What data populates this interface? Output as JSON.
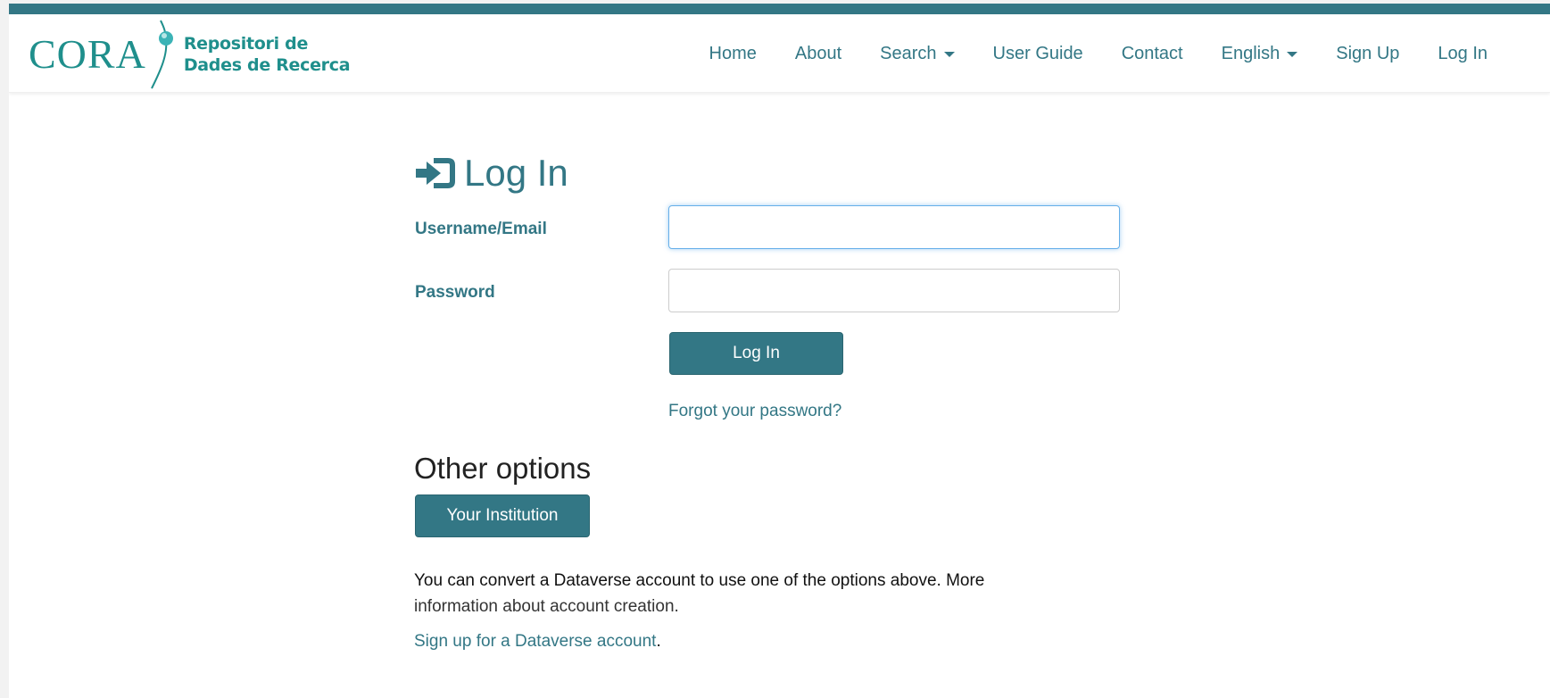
{
  "brand": {
    "logo_text": "CORA",
    "subtitle_line1": "Repositori de",
    "subtitle_line2": "Dades de Recerca",
    "color": "#1f8f8c"
  },
  "colors": {
    "accent": "#337785",
    "topbar": "#337785"
  },
  "nav": {
    "items": [
      {
        "label": "Home",
        "dropdown": false
      },
      {
        "label": "About",
        "dropdown": false
      },
      {
        "label": "Search",
        "dropdown": true
      },
      {
        "label": "User Guide",
        "dropdown": false
      },
      {
        "label": "Contact",
        "dropdown": false
      },
      {
        "label": "English",
        "dropdown": true
      },
      {
        "label": "Sign Up",
        "dropdown": false
      },
      {
        "label": "Log In",
        "dropdown": false
      }
    ]
  },
  "page": {
    "title": "Log In",
    "title_icon": "login-icon"
  },
  "form": {
    "username_label": "Username/Email",
    "username_value": "",
    "password_label": "Password",
    "password_value": "",
    "submit_label": "Log In",
    "forgot_link": "Forgot your password?"
  },
  "other_options": {
    "heading": "Other options",
    "institution_button": "Your Institution",
    "info_text_1": "You can convert a Dataverse account to use one of the options above. More",
    "info_text_2": "information about account creation.",
    "signup_link": "Sign up for a Dataverse account",
    "signup_suffix": "."
  }
}
